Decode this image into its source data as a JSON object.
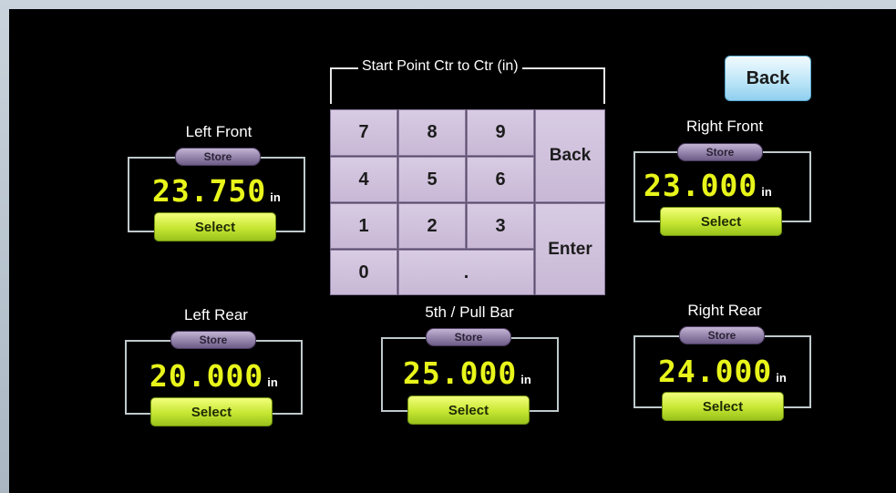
{
  "header": {
    "back_label": "Back"
  },
  "keypad": {
    "title": "Start Point Ctr to Ctr (in)",
    "digits": [
      "7",
      "8",
      "9",
      "4",
      "5",
      "6",
      "1",
      "2",
      "3",
      "0",
      "."
    ],
    "back_label": "Back",
    "enter_label": "Enter"
  },
  "panels": {
    "left_front": {
      "label": "Left Front",
      "store": "Store",
      "value": "23.750",
      "unit": "in",
      "select": "Select"
    },
    "right_front": {
      "label": "Right Front",
      "store": "Store",
      "value": "23.000",
      "unit": "in",
      "select": "Select"
    },
    "left_rear": {
      "label": "Left Rear",
      "store": "Store",
      "value": "20.000",
      "unit": "in",
      "select": "Select"
    },
    "fifth": {
      "label": "5th / Pull Bar",
      "store": "Store",
      "value": "25.000",
      "unit": "in",
      "select": "Select"
    },
    "right_rear": {
      "label": "Right Rear",
      "store": "Store",
      "value": "24.000",
      "unit": "in",
      "select": "Select"
    }
  },
  "colors": {
    "value": "#e8f51a",
    "select": "#c6e632",
    "store": "#8f7ea6",
    "key": "#d0c2de",
    "back": "#bfe6f8"
  }
}
